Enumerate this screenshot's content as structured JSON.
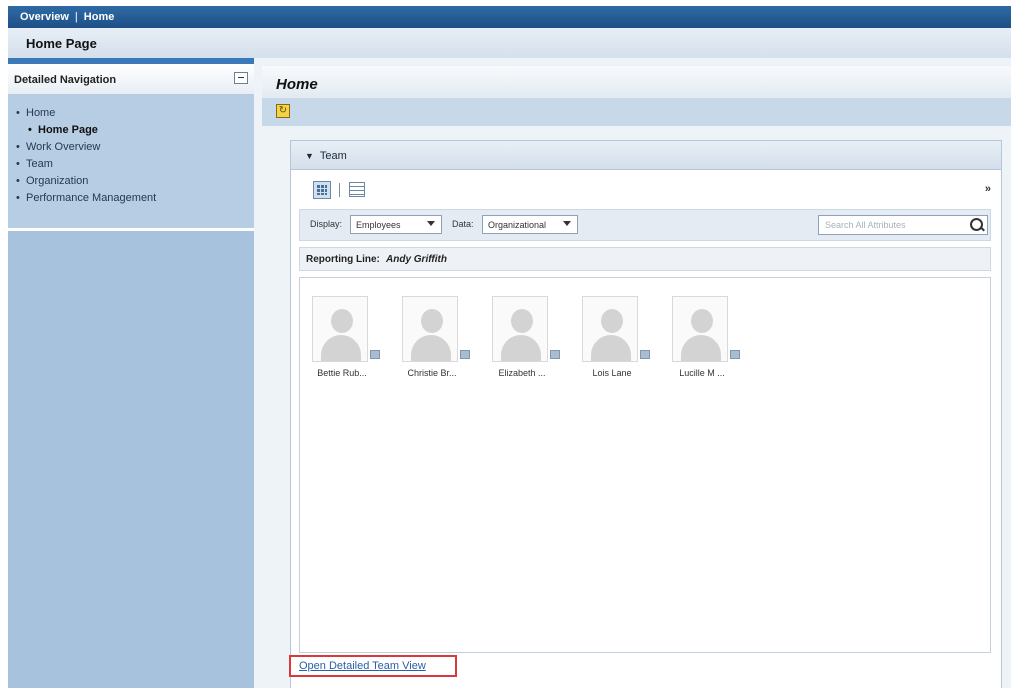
{
  "topbar": {
    "crumb_overview": "Overview",
    "crumb_sep": "|",
    "crumb_home": "Home"
  },
  "page_header": {
    "title": "Home Page"
  },
  "nav": {
    "title": "Detailed Navigation",
    "items": [
      {
        "label": "Home"
      },
      {
        "label": "Home Page"
      },
      {
        "label": "Work Overview"
      },
      {
        "label": "Team"
      },
      {
        "label": "Organization"
      },
      {
        "label": "Performance Management"
      }
    ]
  },
  "main": {
    "title": "Home",
    "toolbar": {
      "refresh_icon": "refresh-icon"
    },
    "team_panel": {
      "title": "Team",
      "collapse_icon": "triangle-down-icon",
      "view_icons": [
        "grid-view-icon",
        "table-view-icon"
      ],
      "more": "»",
      "display_label": "Display:",
      "display_value": "Employees",
      "data_label": "Data:",
      "data_value": "Organizational",
      "search_placeholder": "Search All Attributes",
      "reporting_line_label": "Reporting Line:",
      "reporting_line_value": "Andy Griffith",
      "members": [
        {
          "name": "Bettie Rub..."
        },
        {
          "name": "Christie Br..."
        },
        {
          "name": "Elizabeth ..."
        },
        {
          "name": "Lois Lane"
        },
        {
          "name": "Lucille M ..."
        }
      ],
      "open_detail_link": "Open Detailed Team View"
    }
  }
}
